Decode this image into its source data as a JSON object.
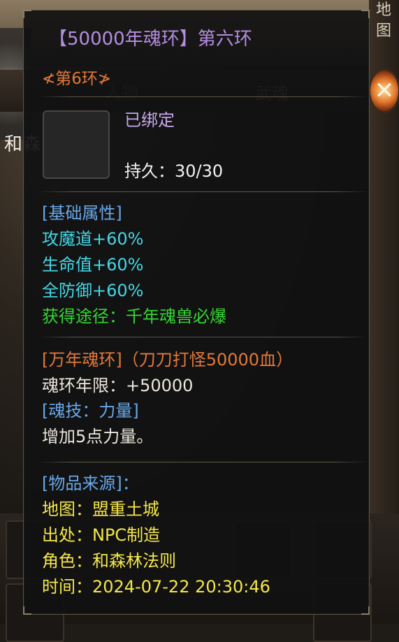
{
  "background": {
    "map_label": "地图",
    "tab_left": "人物",
    "tab_right": "武魂",
    "side_text": "和森"
  },
  "tooltip": {
    "title": "【50000年魂环】第六环",
    "ring_label": "≮第6环≯",
    "bound": "已绑定",
    "durability": "持久：30/30",
    "base_header": "[基础属性]",
    "attributes": [
      "攻魔道+60%",
      "生命值+60%",
      "全防御+60%"
    ],
    "obtain": "获得途径：千年魂兽必爆",
    "ring_type": "[万年魂环]（刀刀打怪50000血）",
    "ring_years": "魂环年限：+50000",
    "skill_header": "[魂技：力量]",
    "skill_desc": "增加5点力量。",
    "source_header": "[物品来源]：",
    "source": {
      "map": "地图：盟重土城",
      "origin": "出处：NPC制造",
      "role": "角色：和森林法则",
      "time": "时间：2024-07-22 20:30:46"
    }
  },
  "colors": {
    "title": "#b38ee0",
    "ring": "#e2773a",
    "attribute": "#44d6e6",
    "header": "#68a8e9",
    "obtain": "#34d733",
    "source": "#f4e64b"
  }
}
